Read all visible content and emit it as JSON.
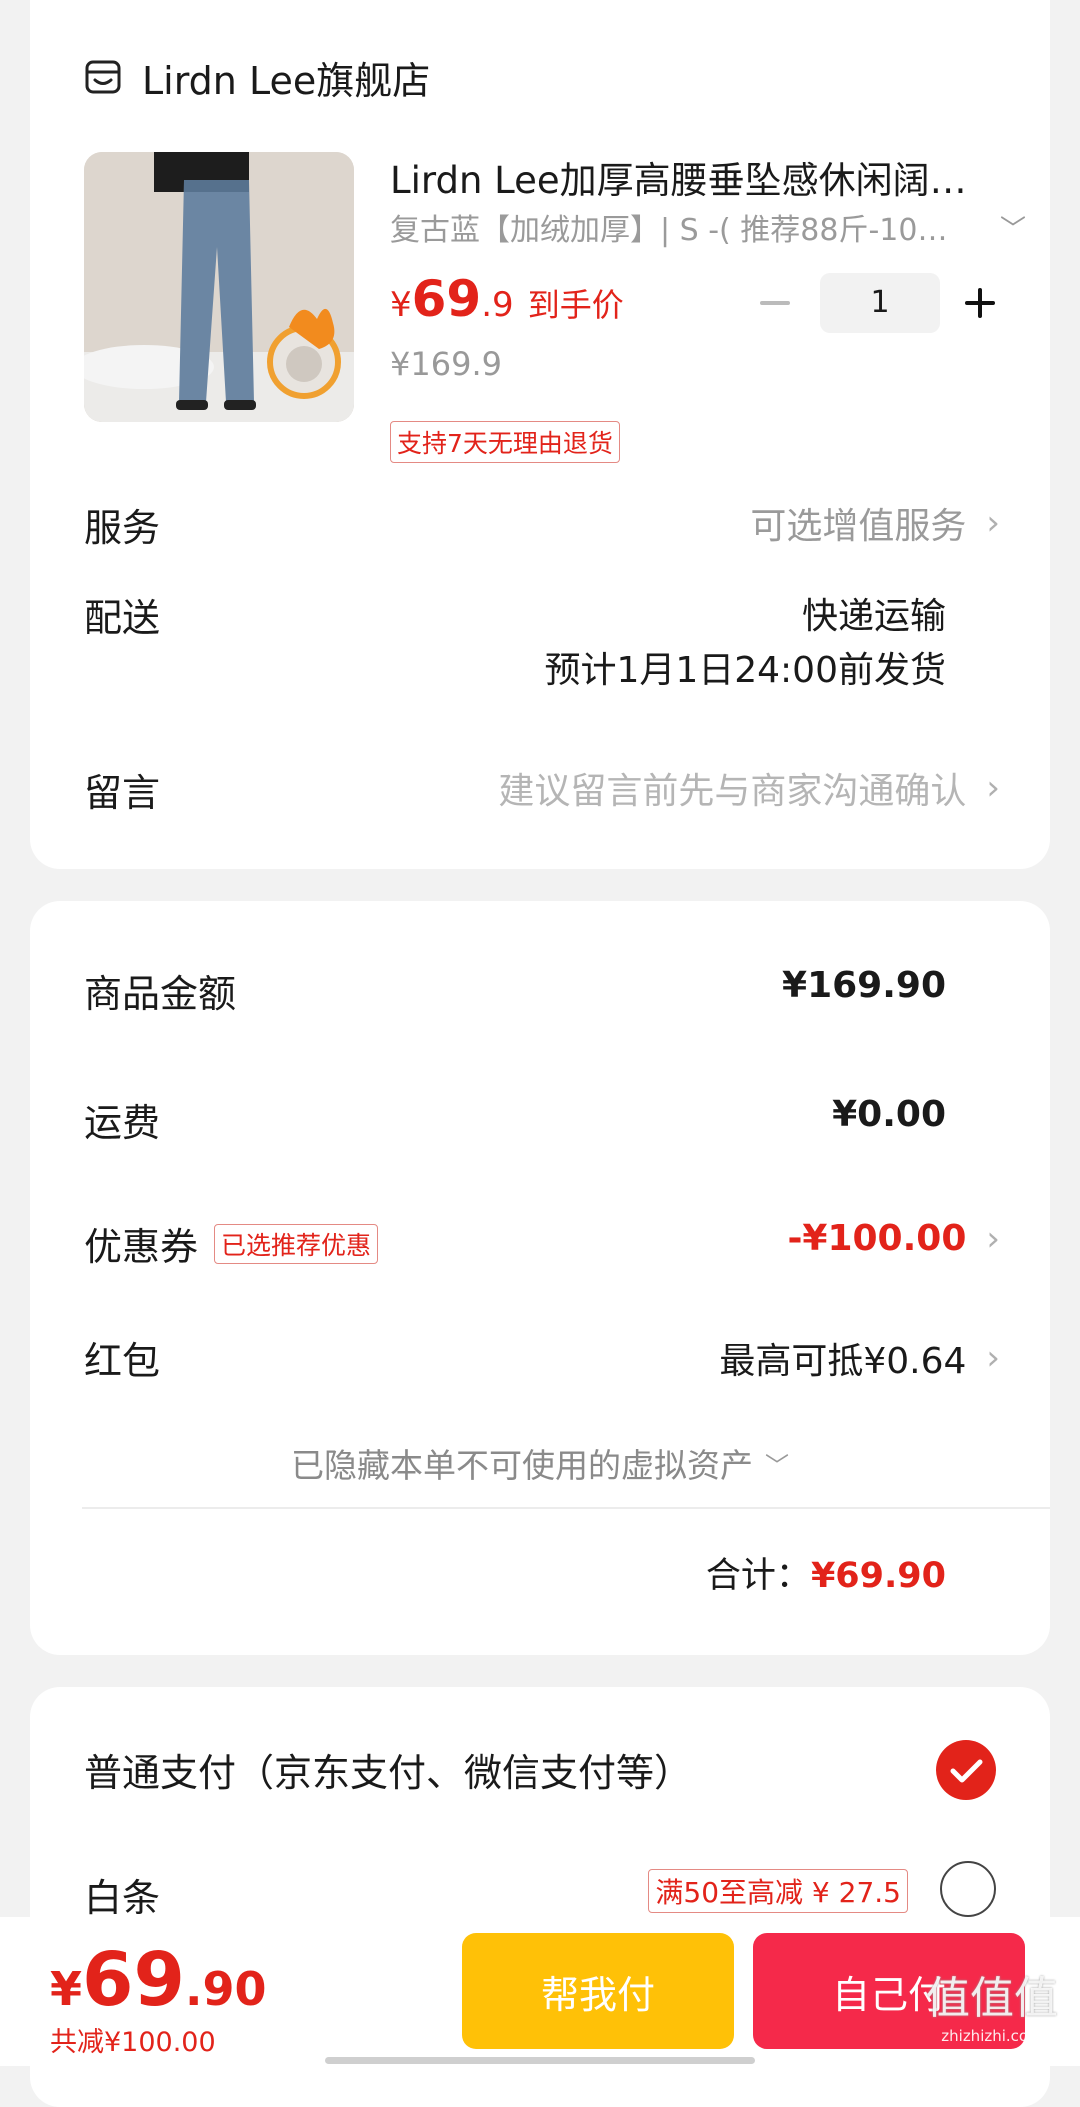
{
  "store": {
    "name": "Lirdn Lee旗舰店",
    "icon": "store-icon"
  },
  "product": {
    "title": "Lirdn Lee加厚高腰垂坠感休闲阔…",
    "variant": "复古蓝【加绒加厚】| S -( 推荐88斤-10…",
    "price_symbol": "¥",
    "price_int": "69",
    "price_dec": ".9",
    "price_tag": "到手价",
    "original_price": "¥169.9",
    "quantity": "1",
    "return_badge": "支持7天无理由退货"
  },
  "service": {
    "label": "服务",
    "value": "可选增值服务"
  },
  "delivery": {
    "label": "配送",
    "method": "快递运输",
    "estimate": "预计1月1日24:00前发货"
  },
  "message": {
    "label": "留言",
    "placeholder": "建议留言前先与商家沟通确认"
  },
  "summary": {
    "goods_label": "商品金额",
    "goods_value": "¥169.90",
    "shipping_label": "运费",
    "shipping_value": "¥0.00",
    "coupon_label": "优惠券",
    "coupon_badge": "已选推荐优惠",
    "coupon_value": "-¥100.00",
    "redpacket_label": "红包",
    "redpacket_value": "最高可抵¥0.64",
    "hidden_assets": "已隐藏本单不可使用的虚拟资产",
    "total_label": "合计：",
    "total_value": "¥69.90"
  },
  "payment": {
    "normal_label": "普通支付（京东支付、微信支付等）",
    "normal_selected": true,
    "baitiao_label": "白条",
    "baitiao_badge": "满50至高减 ¥ 27.5",
    "baitiao_selected": false
  },
  "bottom_bar": {
    "price_symbol": "¥",
    "price_int": "69",
    "price_dec": ".90",
    "saved": "共减¥100.00",
    "help_pay": "帮我付",
    "self_pay": "自己付"
  },
  "watermark": {
    "text": "值值值",
    "sub": "zhizhizhi.com"
  },
  "colors": {
    "accent_red": "#e2231a",
    "help_pay_bg": "#ffc107",
    "self_pay_bg": "#f5294a",
    "background": "#f2f2f2"
  }
}
